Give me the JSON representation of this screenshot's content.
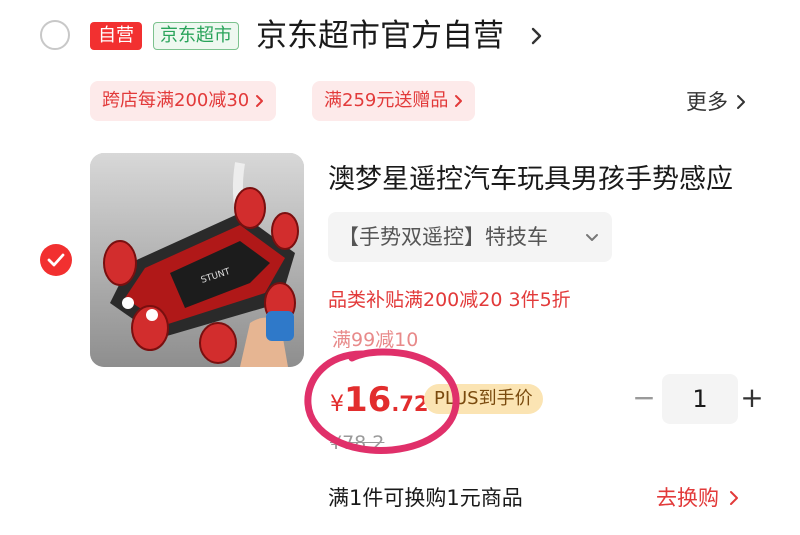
{
  "shop": {
    "self_badge": "自营",
    "market_badge": "京东超市",
    "name": "京东超市官方自营"
  },
  "promotions": {
    "items": [
      {
        "label": "跨店每满200减30"
      },
      {
        "label": "满259元送赠品"
      }
    ],
    "more_label": "更多"
  },
  "product": {
    "title": "澳梦星遥控汽车玩具男孩手势感应",
    "variant": "【手势双遥控】特技车",
    "promo_line": "品类补贴满200减20  3件5折",
    "promo_faded": "满99减10",
    "price": {
      "currency": "¥",
      "integer": "16",
      "decimal": ".72"
    },
    "plus_tag": "PLUS到手价",
    "original_price": "¥78.2",
    "quantity": "1",
    "qty_minus": "−",
    "qty_plus": "+"
  },
  "swap": {
    "text": "满1件可换购1元商品",
    "button": "去换购"
  },
  "colors": {
    "accent_red": "#f23030",
    "price_red": "#e22d2d",
    "annotation_magenta": "#e0306a",
    "market_green": "#29a35a",
    "plus_gold": "#fbe4b3"
  },
  "icons": {
    "shop_chevron": "chevron-right-icon",
    "checked_radio": "check-icon",
    "variant_dropdown": "chevron-down-icon"
  }
}
